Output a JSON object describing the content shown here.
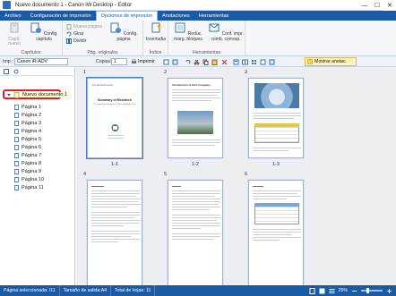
{
  "window": {
    "title": "Nuevo documento 1 - Canon iW Desktop - Editor",
    "minimize": "—",
    "maximize": "☐",
    "close": "✕"
  },
  "ribbon_tabs": [
    {
      "label": "Archivo"
    },
    {
      "label": "Configuración de impresión"
    },
    {
      "label": "Opciones de impresión"
    },
    {
      "label": "Anotaciones"
    },
    {
      "label": "Herramientas"
    }
  ],
  "ribbon": {
    "groups": {
      "capitulos": "Capítulos",
      "pag_originales": "Pág. originales",
      "indice": "Índice",
      "herramientas": "Herramientas"
    },
    "buttons": {
      "capit_nuevo": "Capít. nuevo",
      "config_capitulo": "Config. capítulo",
      "nueva_pagina": "Nueva página",
      "girar": "Girar",
      "dividir": "Dividir",
      "config_pagina": "Config. página",
      "insertudia": "Insertudia",
      "reduc_marg": "Reduc. marg. bloques",
      "conf_impr": "Conf. impr. comb. corresp."
    }
  },
  "toolbar": {
    "printer_label": "Imp.:",
    "printer_value": "Canon iR-ADV",
    "copies_label": "Copias:",
    "copies_value": "1",
    "print_button": "Imprimir",
    "show_annotations": "Mostrar anotac."
  },
  "tree": {
    "root": "Nuevo documento 1",
    "pages": [
      "Página 1",
      "Página 2",
      "Página 3",
      "Página 4",
      "Página 5",
      "Página 6",
      "Página 7",
      "Página 8",
      "Página 9",
      "Página 10",
      "Página 11"
    ]
  },
  "main": {
    "page_numbers": [
      "1",
      "2",
      "3",
      "4",
      "5",
      "6"
    ],
    "thumb_labels": [
      "1-1",
      "1-2",
      "1-3"
    ],
    "thumbs": {
      "p1_header": "For All Documents",
      "p1_title": "Summary of Research",
      "p1_subtitle": "The Data Achievement of TOP for ANNUAL 2007",
      "p2_title": "Introduction of AAA Company"
    }
  },
  "status": {
    "selected": "Página seleccionada: /11",
    "output_size": "Tamaño de salida:A4",
    "total_pages": "Total de hojas: 11",
    "zoom": "25%"
  },
  "colors": {
    "accent": "#1b5aa4",
    "selection_outline": "#e02020"
  }
}
